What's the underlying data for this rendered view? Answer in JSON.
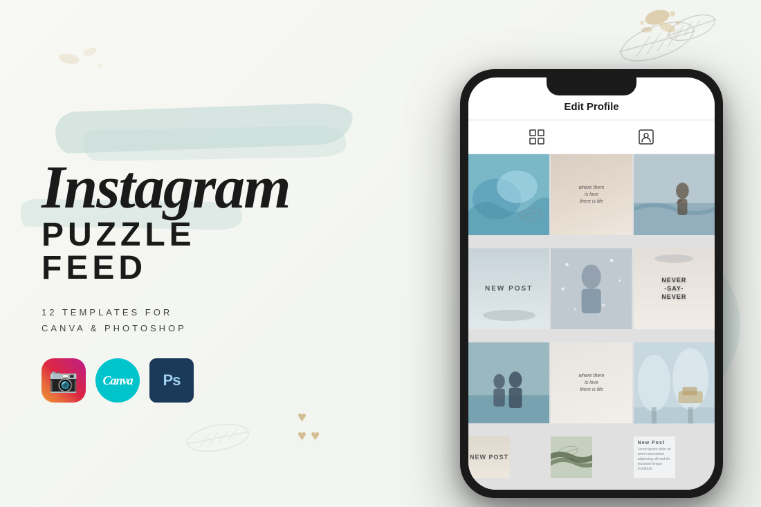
{
  "background": {
    "color": "#f5f5f0"
  },
  "left": {
    "title_script": "Instagram",
    "title_block_1": "PUZZLE",
    "title_block_2": "FEED",
    "subtitle_line1": "12  TEMPLATES  FOR",
    "subtitle_line2": "CANVA & PHOTOSHOP"
  },
  "app_icons": {
    "instagram_label": "Instagram",
    "canva_label": "Canva",
    "ps_label": "Ps"
  },
  "phone": {
    "header_title": "Edit Profile",
    "tabs": [
      "grid-icon",
      "person-tag-icon"
    ],
    "grid": [
      {
        "id": 1,
        "type": "photo",
        "style": "cell-1",
        "text": ""
      },
      {
        "id": 2,
        "type": "quote",
        "style": "cell-2",
        "text": "where there\nis love\nthere is life"
      },
      {
        "id": 3,
        "type": "photo-woman",
        "style": "cell-3",
        "text": ""
      },
      {
        "id": 4,
        "type": "text-label",
        "style": "cell-4",
        "text": "NEW POST"
      },
      {
        "id": 5,
        "type": "photo-blur",
        "style": "cell-5",
        "text": ""
      },
      {
        "id": 6,
        "type": "quote",
        "style": "cell-6",
        "text": "NEVER\n-SAY-\nNEVER"
      },
      {
        "id": 7,
        "type": "photo-beach",
        "style": "cell-7",
        "text": ""
      },
      {
        "id": 8,
        "type": "quote",
        "style": "cell-8",
        "text": "where there\nis love\nthere is life"
      },
      {
        "id": 9,
        "type": "photo-winter",
        "style": "cell-9",
        "text": ""
      },
      {
        "id": 10,
        "type": "text-label",
        "style": "cell-bottom-left",
        "text": "NEW POST"
      },
      {
        "id": 11,
        "type": "photo-hands",
        "style": "cell-bottom-mid",
        "text": ""
      },
      {
        "id": 12,
        "type": "text-small",
        "style": "cell-bottom-right",
        "text": "New Post"
      }
    ]
  }
}
